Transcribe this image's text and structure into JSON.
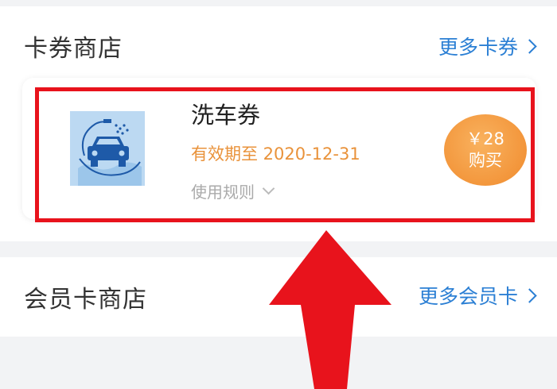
{
  "coupon_store": {
    "title": "卡券商店",
    "more_label": "更多卡券",
    "coupon": {
      "name": "洗车券",
      "expiry": "有效期至 2020-12-31",
      "rules_label": "使用规则",
      "price": "￥28",
      "buy_label": "购买",
      "thumbnail_icon": "car-wash-icon"
    }
  },
  "member_card_store": {
    "title": "会员卡商店",
    "more_label": "更多会员卡"
  },
  "colors": {
    "accent_blue": "#2b7fd4",
    "expiry_orange": "#e9923a",
    "buy_orange": "#f08a2c",
    "annotation_red": "#e8131c"
  }
}
